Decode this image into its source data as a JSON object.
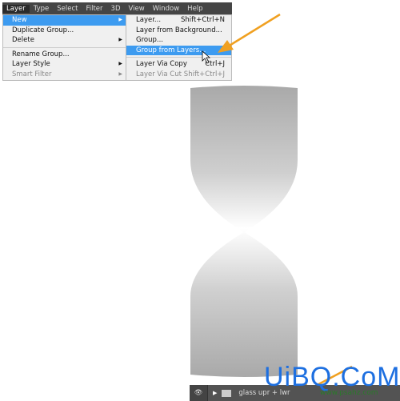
{
  "menubar": {
    "items": [
      "Layer",
      "Type",
      "Select",
      "Filter",
      "3D",
      "View",
      "Window",
      "Help"
    ],
    "active": "Layer"
  },
  "layer_menu": {
    "items": [
      {
        "label": "New",
        "highlighted": true,
        "submenu": true
      },
      {
        "label": "Duplicate Group..."
      },
      {
        "label": "Delete",
        "submenu": true
      },
      {
        "label": "Rename Group..."
      },
      {
        "label": "Layer Style",
        "submenu": true
      },
      {
        "label": "Smart Filter",
        "disabled": true,
        "submenu": true
      }
    ]
  },
  "new_submenu": {
    "items": [
      {
        "label": "Layer...",
        "shortcut": "Shift+Ctrl+N"
      },
      {
        "label": "Layer from Background..."
      },
      {
        "label": "Group..."
      },
      {
        "label": "Group from Layers...",
        "highlighted": true
      },
      {
        "label": "Layer Via Copy",
        "shortcut": "Ctrl+J"
      },
      {
        "label": "Layer Via Cut",
        "shortcut": "Shift+Ctrl+J",
        "disabled": true
      }
    ]
  },
  "layers_panel": {
    "layer_name": "glass upr + lwr",
    "icons": [
      "eye-icon",
      "expand-triangle-icon",
      "folder-icon"
    ]
  },
  "watermark": {
    "logo": "UiBQ.CoM",
    "url": "www.psahz.com"
  },
  "colors": {
    "highlight": "#3d9bf0",
    "arrow": "#f0a020",
    "menubar": "#454545"
  }
}
